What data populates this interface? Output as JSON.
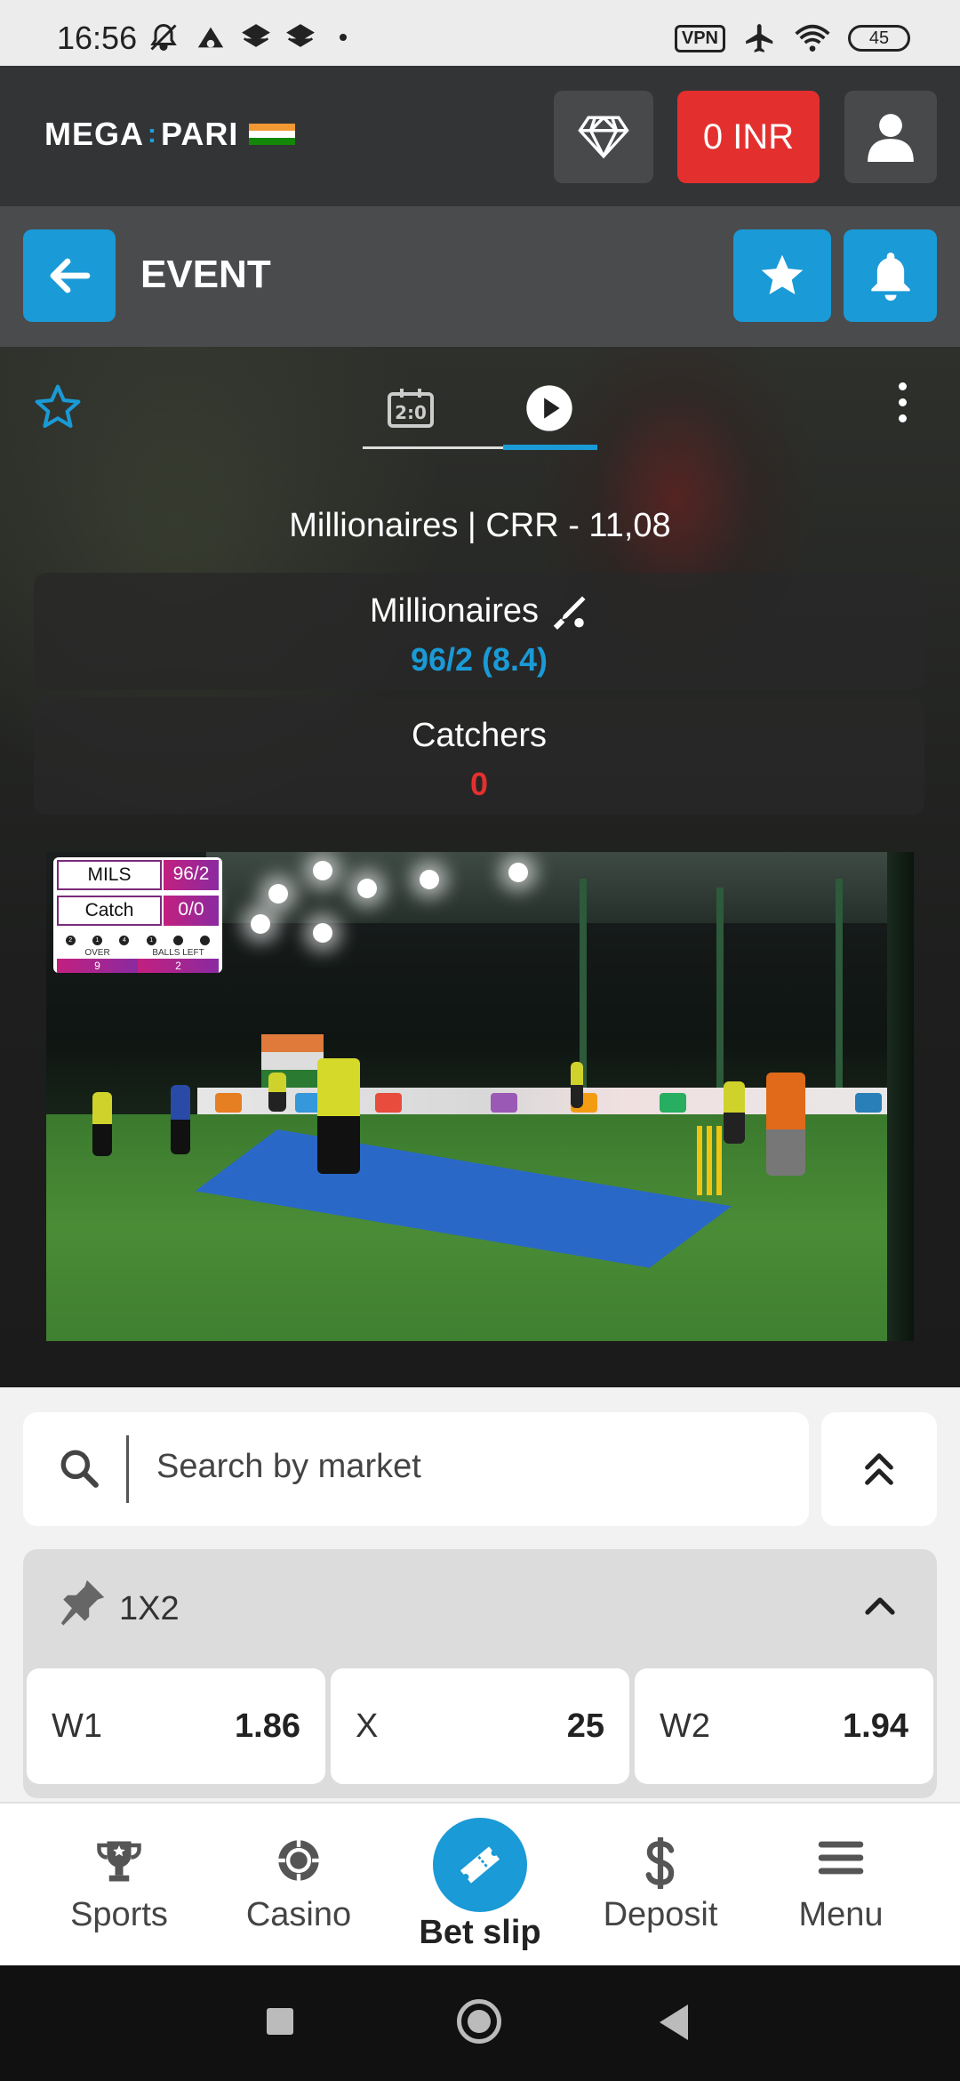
{
  "status_bar": {
    "time": "16:56",
    "vpn": "VPN",
    "battery": "45"
  },
  "header": {
    "logo_left": "MEGA",
    "logo_right": "PARI",
    "balance": "0 INR"
  },
  "event_bar": {
    "title": "EVENT"
  },
  "scoreboard": {
    "crr_text": "Millionaires | CRR - 11,08",
    "team1": {
      "name": "Millionaires",
      "score": "96/2 (8.4)"
    },
    "team2": {
      "name": "Catchers",
      "score": "0"
    }
  },
  "video_overlay": {
    "team1_abbr": "MILS",
    "team1_score": "96/2",
    "team2_abbr": "Catch",
    "team2_score": "0/0",
    "balls": [
      "2",
      "1",
      "4",
      "1",
      "",
      ""
    ],
    "over_label": "OVER",
    "balls_left_label": "BALLS LEFT",
    "over_value": "9",
    "balls_left_value": "2"
  },
  "search": {
    "placeholder": "Search by market"
  },
  "market": {
    "title": "1X2",
    "odds": [
      {
        "label": "W1",
        "value": "1.86"
      },
      {
        "label": "X",
        "value": "25"
      },
      {
        "label": "W2",
        "value": "1.94"
      }
    ]
  },
  "bottom_nav": {
    "sports": "Sports",
    "casino": "Casino",
    "bet_slip": "Bet slip",
    "deposit": "Deposit",
    "menu": "Menu"
  },
  "colors": {
    "accent": "#1a9ad6",
    "danger": "#e3302f",
    "header": "#333436"
  }
}
